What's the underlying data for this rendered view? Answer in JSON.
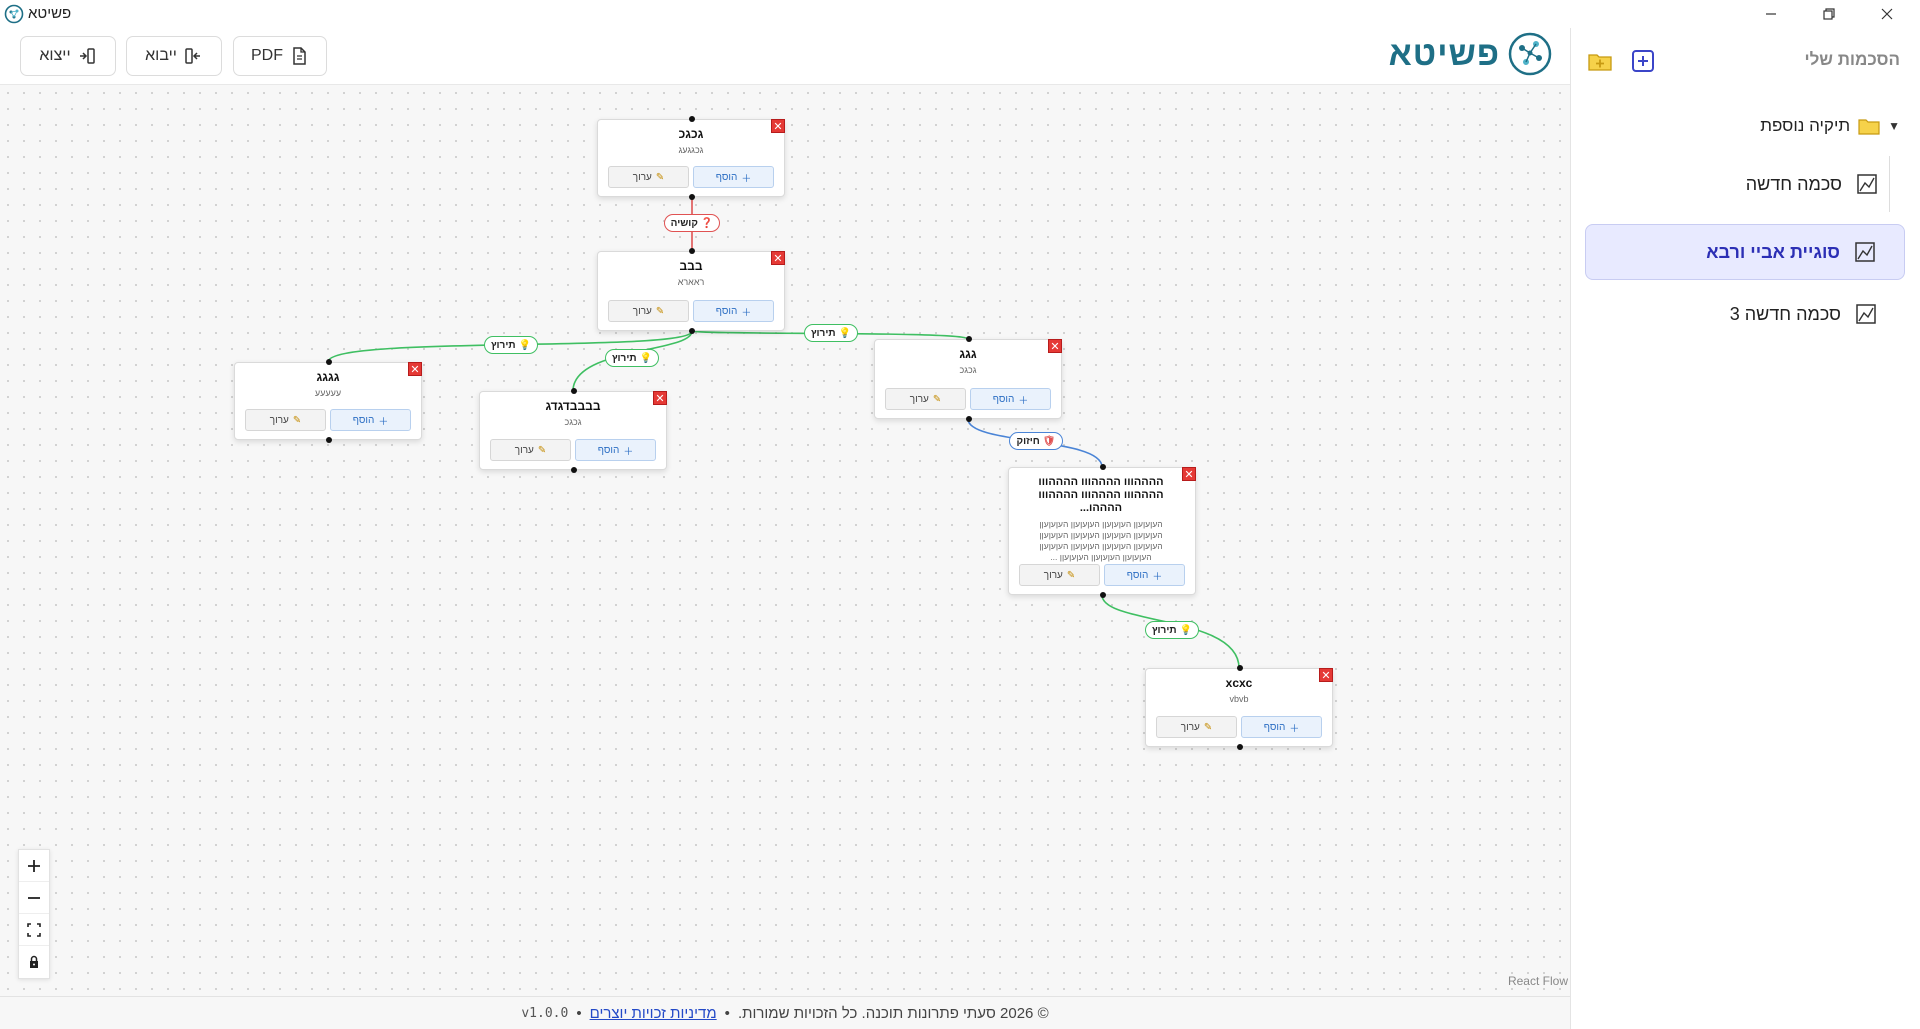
{
  "window": {
    "title": "פשיטא"
  },
  "toolbar": {
    "export_label": "ייצוא",
    "import_label": "ייבוא",
    "pdf_label": "PDF",
    "logo_text": "פשיטא"
  },
  "sidebar": {
    "title": "הסכמות שלי",
    "folder_label": "תיקיה נוספת",
    "items": [
      {
        "label": "סכמה חדשה"
      },
      {
        "label": "סוגיית אביי ורבא"
      },
      {
        "label": "סכמה חדשה 3"
      }
    ]
  },
  "nodes": [
    {
      "title": "גכגכ",
      "subtitle": "גכגגעג"
    },
    {
      "title": "בבב",
      "subtitle": "ראארא"
    },
    {
      "title": "גגגג",
      "subtitle": "עעעעע"
    },
    {
      "title": "בבבבדגדג",
      "subtitle": "גכגכ"
    },
    {
      "title": "גגג",
      "subtitle": "גכגכ"
    },
    {
      "title": "ההההווו ההההווו ההההווו ההההווו ההההווו ההההווו ההההו...",
      "subtitle": "העןעןעןן העןעןעןן העןעןעןן העןעןעןן העןעןעןן העןעןעןן העןעןעןן העןעןעןן העןעןעןן העןעןעןן העןעןעןן העןעןעןן העןעןעןן העןעןעןן העןעןעןן ..."
    },
    {
      "title": "xcxc",
      "subtitle": "vbvb"
    }
  ],
  "node_buttons": {
    "add": "הוסף",
    "edit": "ערוך"
  },
  "edges": [
    {
      "label": "קושיה",
      "kind": "red"
    },
    {
      "label": "תירוץ",
      "kind": "green"
    },
    {
      "label": "תירוץ",
      "kind": "green"
    },
    {
      "label": "תירוץ",
      "kind": "green"
    },
    {
      "label": "חיזוק",
      "kind": "blue"
    },
    {
      "label": "תירוץ",
      "kind": "green"
    }
  ],
  "canvas": {
    "attribution": "React Flow"
  },
  "footer": {
    "copyright": "© 2026 סעתי פתרונות תוכנה. כל הזכויות שמורות.",
    "policy_link": "מדיניות זכויות יוצרים",
    "separator": "•",
    "version": "v1.0.0"
  },
  "colors": {
    "green_edge": "#3fbf62",
    "red_edge": "#e05252",
    "blue_edge": "#4a84d6",
    "active_bg": "#e8eaff",
    "logo": "#1e6f86"
  }
}
